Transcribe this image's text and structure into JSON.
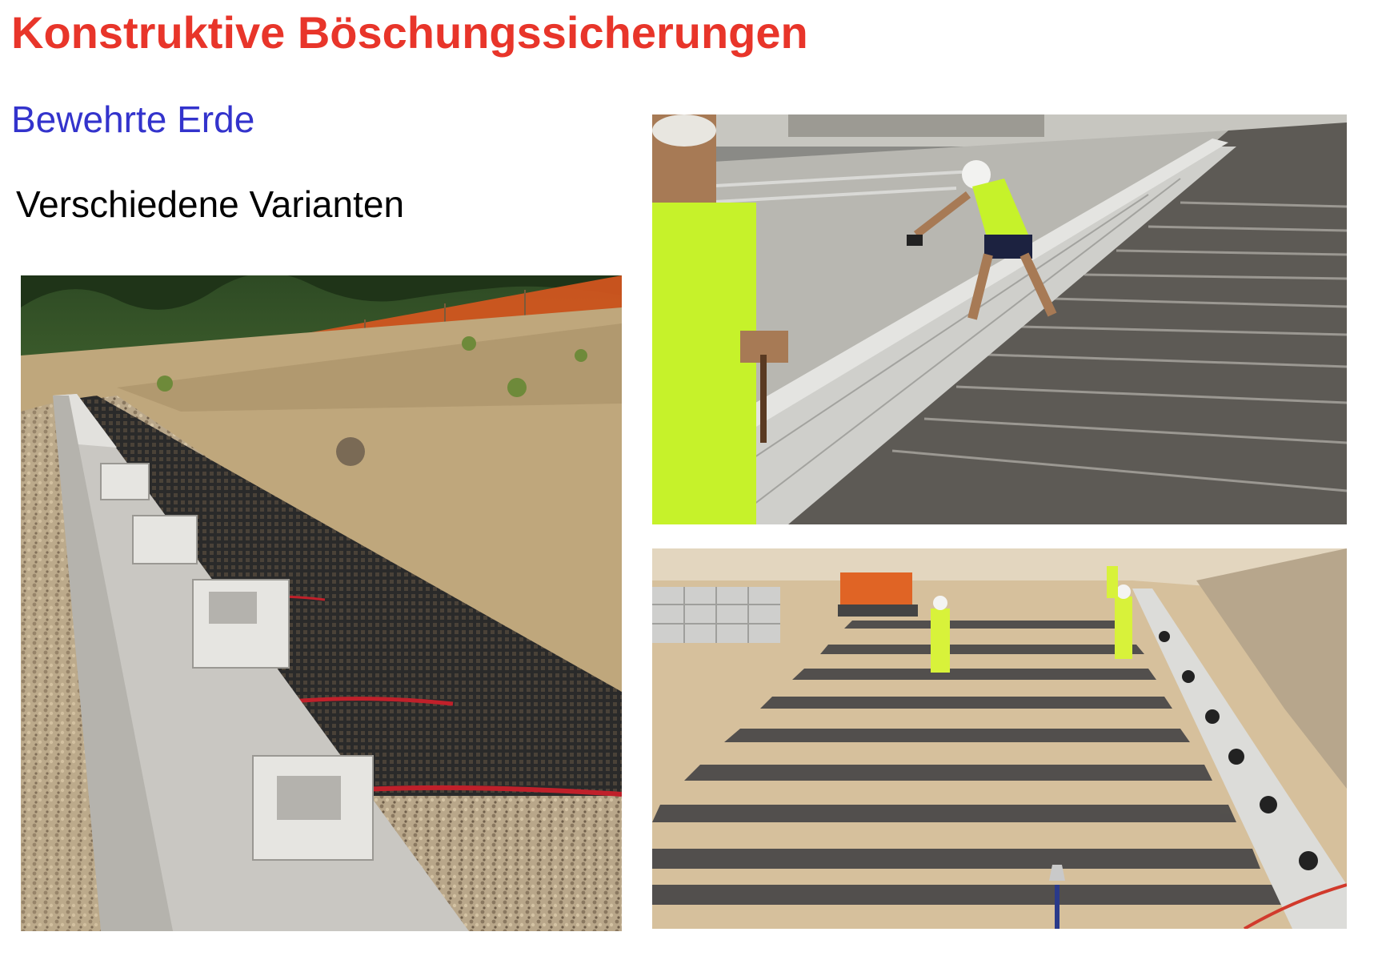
{
  "slide": {
    "title": "Konstruktive Böschungssicherungen",
    "subtitle": "Bewehrte Erde",
    "subheading": "Verschiedene Varianten"
  },
  "photos": [
    {
      "name": "photo-wall-geogrid"
    },
    {
      "name": "photo-workers-steel-mesh"
    },
    {
      "name": "photo-geogrid-strips"
    }
  ],
  "colors": {
    "title": "#e8352a",
    "subtitle": "#3333cc",
    "subheading": "#000000"
  }
}
